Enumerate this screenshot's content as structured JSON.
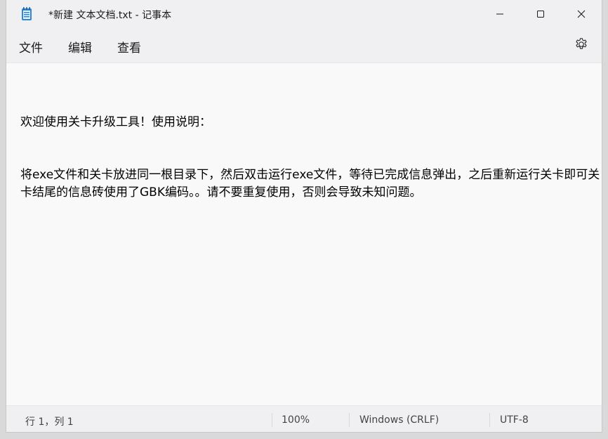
{
  "window": {
    "title": "*新建 文本文档.txt - 记事本",
    "app_icon": "notepad-icon"
  },
  "controls": {
    "minimize_icon": "minimize-icon",
    "maximize_icon": "maximize-icon",
    "close_icon": "close-icon"
  },
  "menu": {
    "file": "文件",
    "edit": "编辑",
    "view": "查看",
    "settings_icon": "gear-icon"
  },
  "editor": {
    "lines": [
      "欢迎使用关卡升级工具！使用说明：",
      "将exe文件和关卡放进同一根目录下，然后双击运行exe文件，等待已完成信息弹出，之后重新运行关卡即可关卡结尾的信息砖使用了GBK编码。。请不要重复使用，否则会导致未知问题。"
    ]
  },
  "status": {
    "position": "行 1，列 1",
    "zoom": "100%",
    "line_ending": "Windows (CRLF)",
    "encoding": "UTF-8"
  },
  "colors": {
    "accent": "#2b88d8",
    "editor_bg": "#f9f9f9",
    "chrome_bg": "#f0f0f3"
  }
}
